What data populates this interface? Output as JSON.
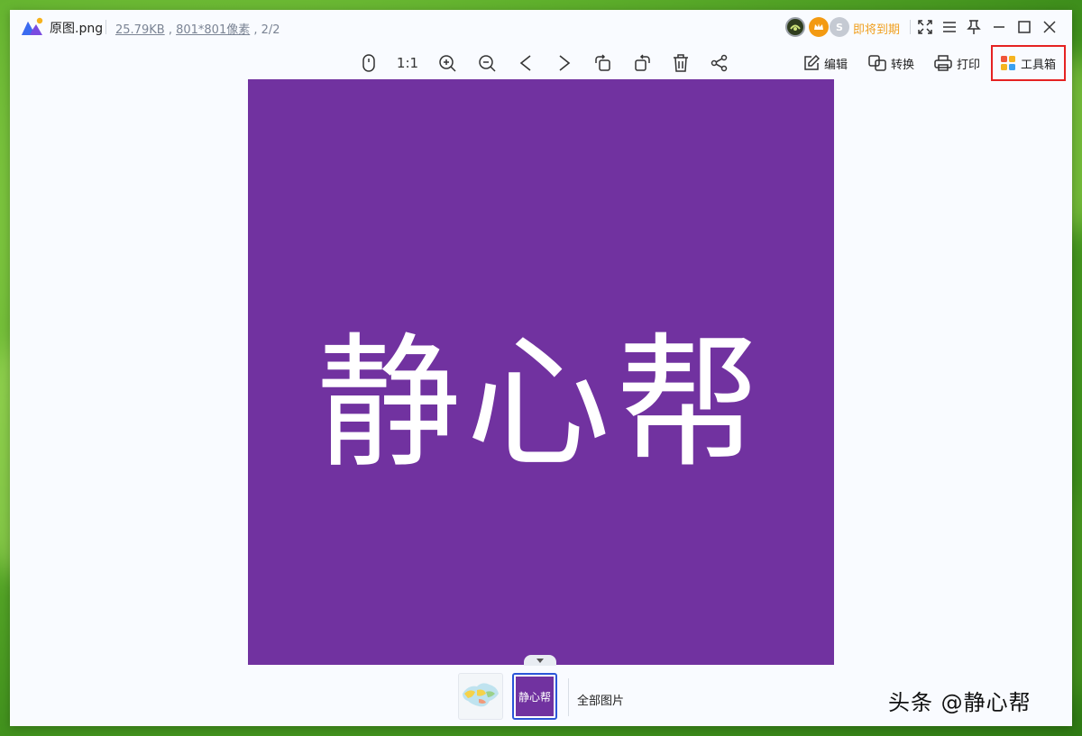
{
  "window": {
    "file_name": "原图.png",
    "file_size": "25.79KB",
    "dimensions": "801*801像素",
    "page_counter": ", 2/2",
    "membership_status": "即将到期",
    "badges": [
      {
        "icon": "avatar-badge",
        "color": "#2f3d1e"
      },
      {
        "icon": "crown-badge",
        "color": "#f39a12"
      },
      {
        "icon": "s-coin-badge",
        "color": "#c5cad3",
        "label": "S"
      }
    ],
    "controls": [
      "fullscreen-icon",
      "menu-icon",
      "pin-icon",
      "minimize-icon",
      "maximize-icon",
      "close-icon"
    ]
  },
  "toolbar": {
    "zoom_1to1": "1:1",
    "actions": [
      {
        "icon": "edit-icon",
        "label": "编辑"
      },
      {
        "icon": "convert-icon",
        "label": "转换"
      },
      {
        "icon": "print-icon",
        "label": "打印"
      },
      {
        "icon": "toolbox-icon",
        "label": "工具箱"
      }
    ]
  },
  "image": {
    "text": "静心帮",
    "background": "#7132a0"
  },
  "thumbnails": {
    "active_label": "静心帮",
    "all_images": "全部图片"
  },
  "watermark": "头条 @静心帮",
  "colors": {
    "accent": "#2b55d8",
    "highlight": "#e52222",
    "warning": "#f0a020"
  }
}
